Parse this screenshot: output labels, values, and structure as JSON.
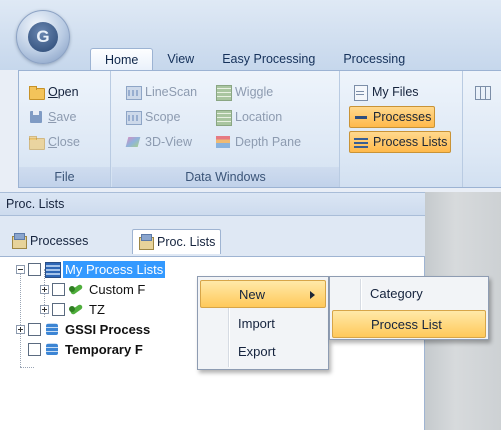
{
  "app": {
    "logo_letter": "G",
    "tabs": [
      "Home",
      "View",
      "Easy Processing",
      "Processing"
    ],
    "active_tab": "Home"
  },
  "ribbon": {
    "file": {
      "label": "File",
      "open": {
        "accel": "O",
        "rest": "pen"
      },
      "save": {
        "accel": "S",
        "rest": "ave"
      },
      "close": {
        "accel": "C",
        "rest": "lose"
      }
    },
    "data_windows": {
      "label": "Data Windows",
      "linescan": "LineScan",
      "scope": "Scope",
      "view3d": "3D-View",
      "wiggle": "Wiggle",
      "location": "Location",
      "depth_pane": "Depth Pane"
    },
    "misc": {
      "my_files": "My Files",
      "processes": "Processes",
      "process_lists": "Process Lists"
    }
  },
  "pane": {
    "title": "Proc. Lists",
    "tabs": [
      "Processes",
      "Proc. Lists"
    ],
    "active_tab": "Proc. Lists"
  },
  "tree": {
    "items": [
      {
        "label": "My Process Lists",
        "selected": true
      },
      {
        "label": "Custom F"
      },
      {
        "label": "TZ"
      },
      {
        "label": "GSSI Process",
        "bold": true
      },
      {
        "label": "Temporary F",
        "bold": true
      }
    ]
  },
  "context_menu": {
    "items": [
      "New",
      "Import",
      "Export"
    ],
    "highlighted": "New"
  },
  "submenu": {
    "items": [
      "Category",
      "Process List"
    ],
    "highlighted": "Process List"
  },
  "colors": {
    "selection": "#3399ff",
    "menu_highlight": "#ffc95a",
    "ribbon_bg": "#dde8f5"
  }
}
